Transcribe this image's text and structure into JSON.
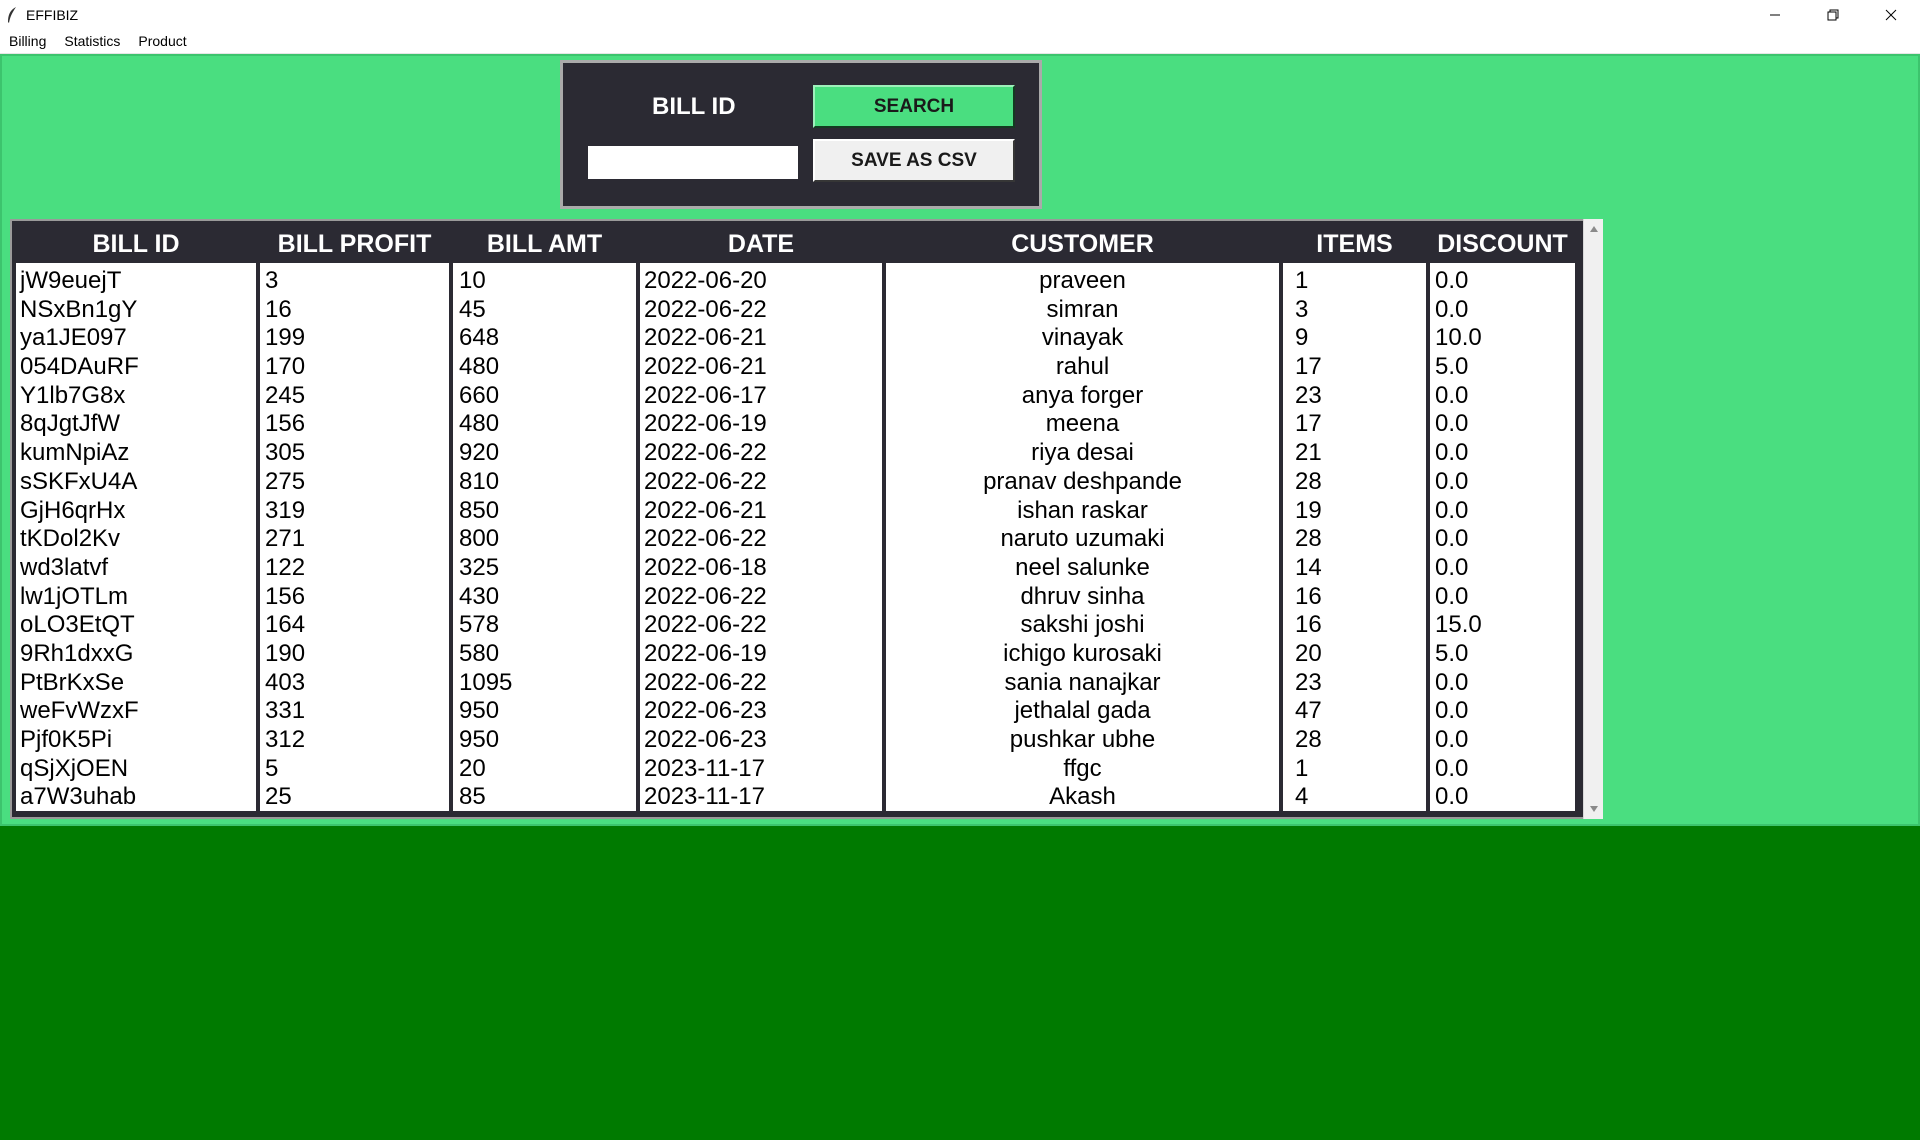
{
  "window": {
    "title": "EFFIBIZ",
    "icon": "feather-icon",
    "controls": [
      "minimize-icon",
      "restore-icon",
      "close-icon"
    ]
  },
  "menu": {
    "items": [
      {
        "label": "Billing"
      },
      {
        "label": "Statistics"
      },
      {
        "label": "Product"
      }
    ]
  },
  "search": {
    "label": "BILL ID",
    "value": "",
    "search_button": "SEARCH",
    "csv_button": "SAVE AS CSV"
  },
  "table": {
    "columns": [
      "BILL ID",
      "BILL PROFIT",
      "BILL AMT",
      "DATE",
      "CUSTOMER",
      "ITEMS",
      "DISCOUNT"
    ],
    "rows": [
      [
        "jW9euejT",
        "3",
        "10",
        "2022-06-20",
        "praveen",
        "1",
        "0.0"
      ],
      [
        "NSxBn1gY",
        "16",
        "45",
        "2022-06-22",
        "simran",
        "3",
        "0.0"
      ],
      [
        "ya1JE097",
        "199",
        "648",
        "2022-06-21",
        "vinayak",
        "9",
        "10.0"
      ],
      [
        "054DAuRF",
        "170",
        "480",
        "2022-06-21",
        "rahul",
        "17",
        "5.0"
      ],
      [
        "Y1lb7G8x",
        "245",
        "660",
        "2022-06-17",
        "anya forger",
        "23",
        "0.0"
      ],
      [
        "8qJgtJfW",
        "156",
        "480",
        "2022-06-19",
        "meena",
        "17",
        "0.0"
      ],
      [
        "kumNpiAz",
        "305",
        "920",
        "2022-06-22",
        "riya desai",
        "21",
        "0.0"
      ],
      [
        "sSKFxU4A",
        "275",
        "810",
        "2022-06-22",
        "pranav deshpande",
        "28",
        "0.0"
      ],
      [
        "GjH6qrHx",
        "319",
        "850",
        "2022-06-21",
        "ishan raskar",
        "19",
        "0.0"
      ],
      [
        "tKDol2Kv",
        "271",
        "800",
        "2022-06-22",
        "naruto uzumaki",
        "28",
        "0.0"
      ],
      [
        "wd3latvf",
        "122",
        "325",
        "2022-06-18",
        "neel salunke",
        "14",
        "0.0"
      ],
      [
        "lw1jOTLm",
        "156",
        "430",
        "2022-06-22",
        "dhruv sinha",
        "16",
        "0.0"
      ],
      [
        "oLO3EtQT",
        "164",
        "578",
        "2022-06-22",
        "sakshi joshi",
        "16",
        "15.0"
      ],
      [
        "9Rh1dxxG",
        "190",
        "580",
        "2022-06-19",
        "ichigo kurosaki",
        "20",
        "5.0"
      ],
      [
        "PtBrKxSe",
        "403",
        "1095",
        "2022-06-22",
        "sania nanajkar",
        "23",
        "0.0"
      ],
      [
        "weFvWzxF",
        "331",
        "950",
        "2022-06-23",
        "jethalal gada",
        "47",
        "0.0"
      ],
      [
        "Pjf0K5Pi",
        "312",
        "950",
        "2022-06-23",
        "pushkar ubhe",
        "28",
        "0.0"
      ],
      [
        "qSjXjOEN",
        "5",
        "20",
        "2023-11-17",
        "ffgc",
        "1",
        "0.0"
      ],
      [
        "a7W3uhab",
        "25",
        "85",
        "2023-11-17",
        "Akash",
        "4",
        "0.0"
      ]
    ]
  },
  "colors": {
    "panel": "#4ade80",
    "background": "#007a00",
    "header": "#2b2a33"
  }
}
